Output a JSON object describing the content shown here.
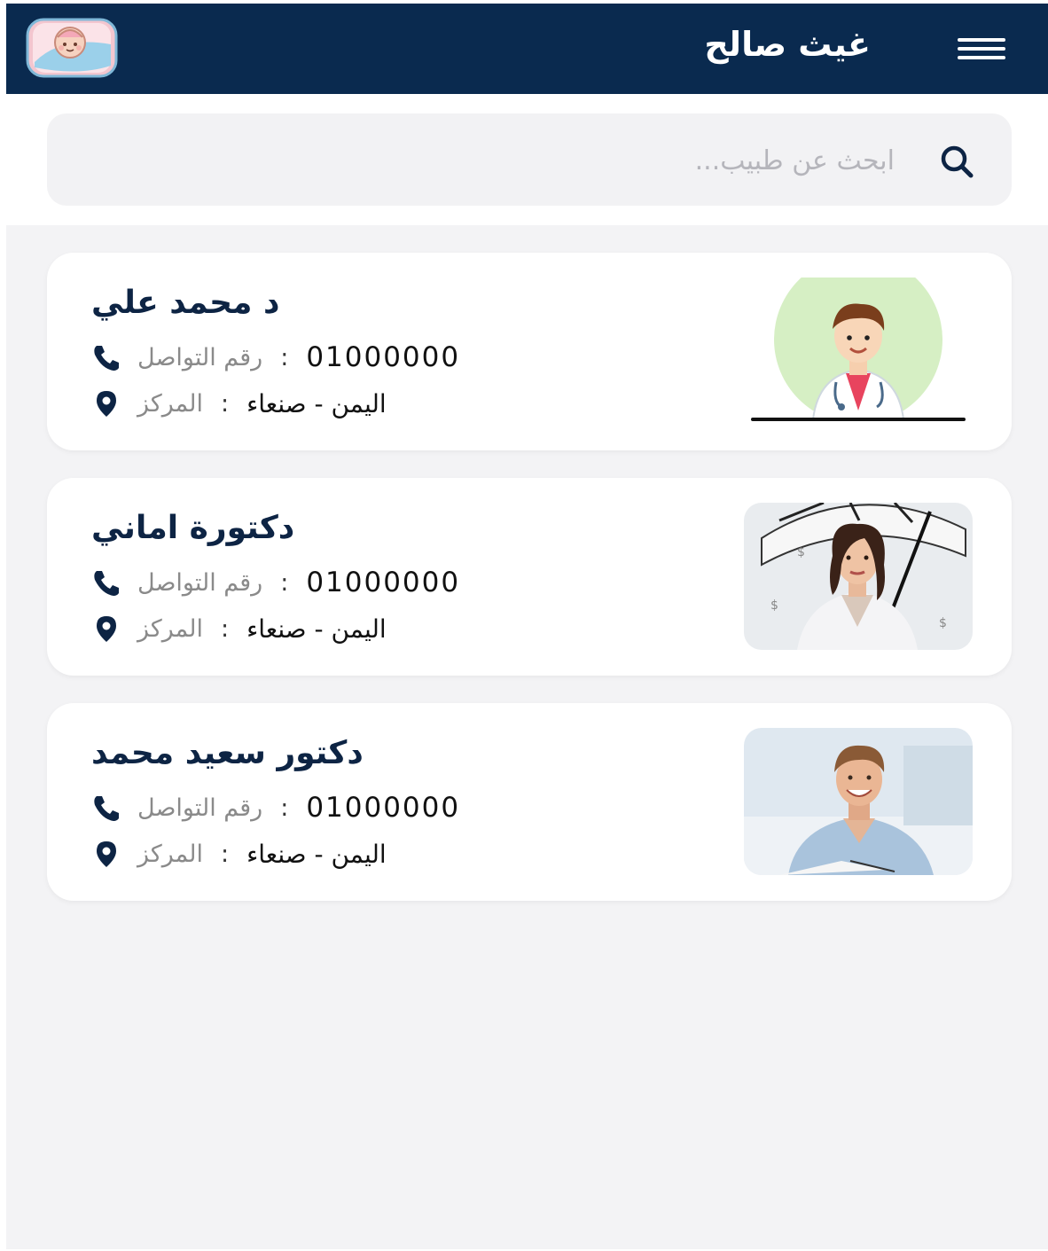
{
  "header": {
    "title": "غيث صالح",
    "menu_icon": "hamburger-menu-icon",
    "logo_icon": "baby-logo-icon"
  },
  "search": {
    "placeholder": "ابحث عن طبيب...",
    "value": "",
    "icon": "search-icon"
  },
  "doctors": [
    {
      "name": "د محمد علي",
      "phone_label": "رقم التواصل",
      "phone": "01000000",
      "center_label": "المركز",
      "center": "اليمن - صنعاء",
      "photo": "doctor-cartoon-avatar"
    },
    {
      "name": "دكتورة اماني",
      "phone_label": "رقم التواصل",
      "phone": "01000000",
      "center_label": "المركز",
      "center": "اليمن - صنعاء",
      "photo": "woman-with-umbrella-photo"
    },
    {
      "name": "دكتور سعيد محمد",
      "phone_label": "رقم التواصل",
      "phone": "01000000",
      "center_label": "المركز",
      "center": "اليمن - صنعاء",
      "photo": "smiling-man-photo"
    }
  ],
  "colors": {
    "header_bg": "#0a2a4f",
    "name_text": "#0d2444",
    "page_bg": "#f3f3f5"
  }
}
